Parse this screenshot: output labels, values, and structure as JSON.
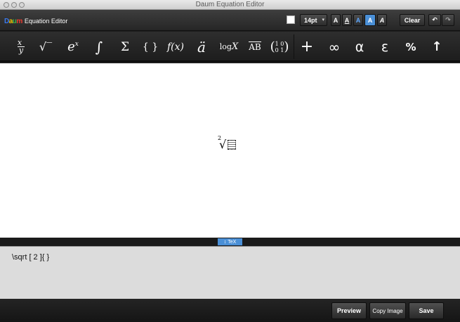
{
  "window": {
    "title": "Daum Equation Editor"
  },
  "header": {
    "logo_mark": "Daum",
    "logo_text": "Equation Editor",
    "font_color": "#ffffff",
    "font_size": "14pt",
    "style_buttons": [
      "A",
      "A",
      "A",
      "A",
      "A"
    ],
    "clear_label": "Clear",
    "undo_icon": "undo-icon",
    "redo_icon": "redo-icon"
  },
  "toolbar": {
    "symbols": [
      {
        "name": "fraction",
        "glyph": "x/y"
      },
      {
        "name": "square-root",
        "glyph": "√‾"
      },
      {
        "name": "exponent",
        "glyph": "eˣ"
      },
      {
        "name": "integral",
        "glyph": "∫"
      },
      {
        "name": "summation",
        "glyph": "Σ"
      },
      {
        "name": "brackets",
        "glyph": "{ }"
      },
      {
        "name": "function",
        "glyph": "f(x)"
      },
      {
        "name": "accent",
        "glyph": "ä"
      },
      {
        "name": "logarithm",
        "glyph": "logX"
      },
      {
        "name": "overline",
        "glyph": "AB"
      },
      {
        "name": "matrix",
        "glyph": "(1 0 / 0 1)"
      },
      {
        "name": "operator",
        "glyph": "+"
      },
      {
        "name": "infinity",
        "glyph": "∞"
      },
      {
        "name": "greek-alpha",
        "glyph": "α"
      },
      {
        "name": "greek-epsilon",
        "glyph": "ε"
      },
      {
        "name": "percent",
        "glyph": "%"
      },
      {
        "name": "arrow",
        "glyph": "↑"
      }
    ]
  },
  "canvas": {
    "equation_index": "2",
    "equation_root": "√"
  },
  "divider": {
    "tab_label": "TeX"
  },
  "source": {
    "latex": "\\sqrt [ 2 ]{  }"
  },
  "footer": {
    "preview_label": "Preview",
    "copy_label": "Copy Image",
    "save_label": "Save"
  }
}
